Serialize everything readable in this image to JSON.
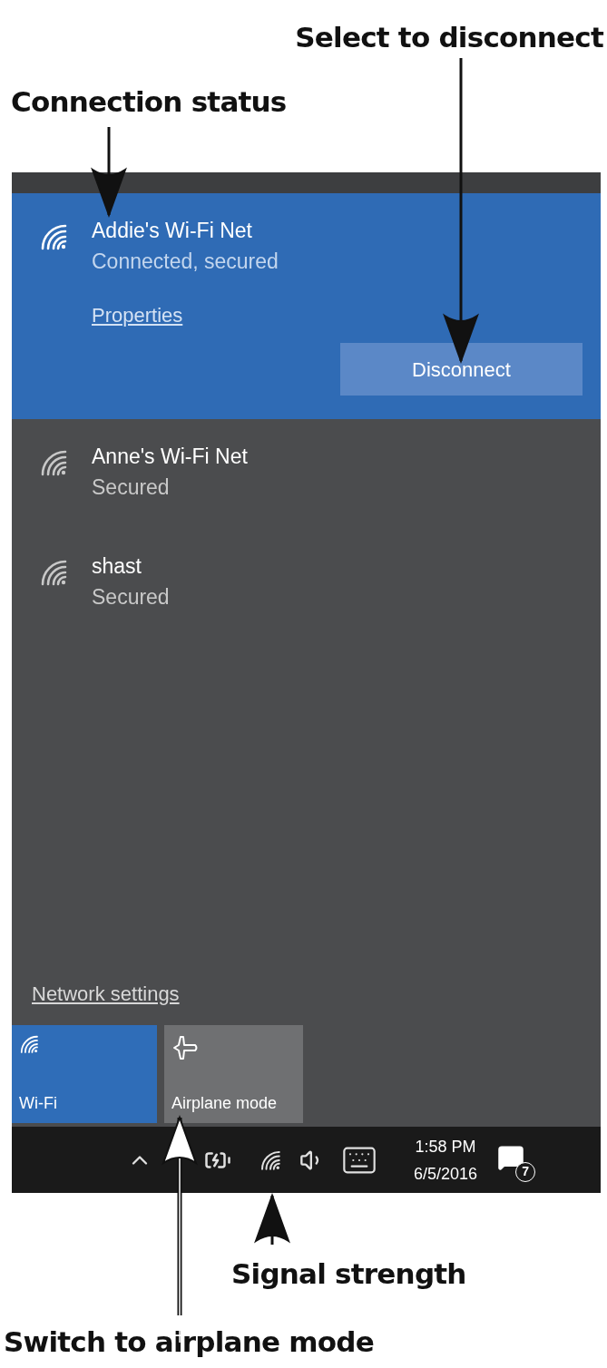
{
  "callouts": {
    "disconnect": "Select to disconnect",
    "connection_status": "Connection status",
    "signal_strength": "Signal strength",
    "airplane_mode": "Switch to airplane mode"
  },
  "networks": [
    {
      "name": "Addie's Wi-Fi Net",
      "status": "Connected, secured",
      "selected": true,
      "properties_link": "Properties",
      "action_button": "Disconnect"
    },
    {
      "name": "Anne's Wi-Fi Net",
      "status": "Secured",
      "selected": false
    },
    {
      "name": "shast",
      "status": "Secured",
      "selected": false
    }
  ],
  "network_settings_link": "Network settings",
  "quick_actions": [
    {
      "kind": "wifi",
      "label": "Wi-Fi",
      "on": true
    },
    {
      "kind": "airplane",
      "label": "Airplane mode",
      "on": false
    }
  ],
  "taskbar": {
    "time": "1:58 PM",
    "date": "6/5/2016",
    "notification_count": "7"
  }
}
